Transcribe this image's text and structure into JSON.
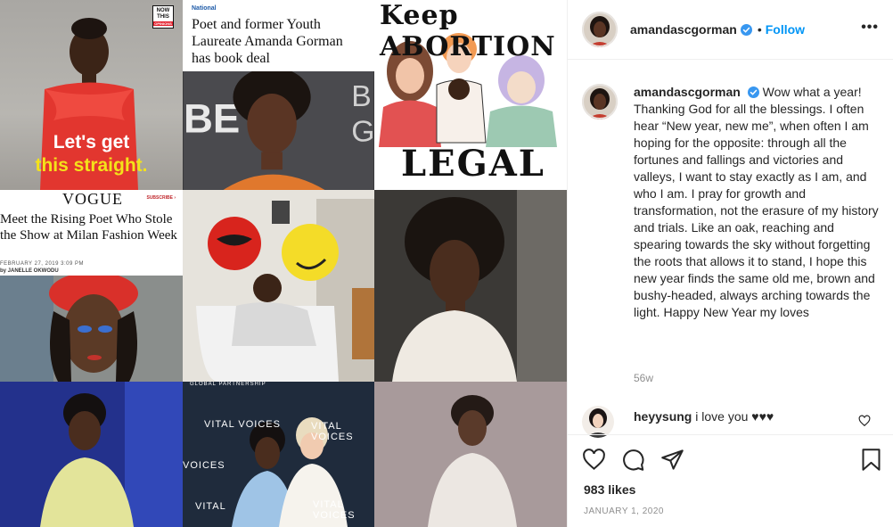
{
  "grid": {
    "tile1": {
      "logo_lines": [
        "NOW",
        "THIS"
      ],
      "logo_sub": "OPINIONS",
      "caption_line1": "Let's get",
      "caption_line2": "this straight."
    },
    "tile2": {
      "section": "National",
      "headline": "Poet and former Youth Laureate Amanda Gorman has book deal"
    },
    "tile3": {
      "top_text": "Keep ABORTION",
      "bottom_text": "LEGAL"
    },
    "tile4": {
      "masthead": "VOGUE",
      "subscribe": "SUBSCRIBE ›",
      "headline": "Meet the Rising Poet Who Stole the Show at Milan Fashion Week",
      "date": "FEBRUARY 27, 2019 3:09 PM",
      "author": "by JANELLE OKWODU"
    },
    "tile8": {
      "watermarks": [
        "VITAL VOICES",
        "VITAL VOICES",
        "VITAL VOICES",
        "VOICES",
        "VITAL"
      ],
      "banner_top": "GLOBAL PARTNERSHIP"
    }
  },
  "post": {
    "username": "amandascgorman",
    "verified": true,
    "follow_label": "Follow",
    "more_label": "•••",
    "caption": "Wow what a year! Thanking God for all the blessings. I often hear “New year, new me”, when often I am hoping for the opposite: through all the fortunes and fallings and victories and valleys, I want to stay exactly as I am, and who I am. I pray for growth and transformation, not the erasure of my history and trials. Like an oak, reaching and spearing towards the sky without forgetting the roots that allows it to stand, I hope this new year finds the same old me, brown and bushy-headed, always arching towards the light. Happy New Year my loves",
    "age": "56w",
    "comment": {
      "username": "heyysung",
      "text": "i love you ♥♥♥"
    },
    "likes": "983 likes",
    "date": "JANUARY 1, 2020"
  },
  "icons": [
    "heart-icon",
    "comment-icon",
    "share-icon",
    "bookmark-icon",
    "verified-icon",
    "more-icon"
  ],
  "colors": {
    "link": "#0095f6",
    "text": "#262626",
    "muted": "#8e8e8e",
    "border": "#efefef"
  }
}
